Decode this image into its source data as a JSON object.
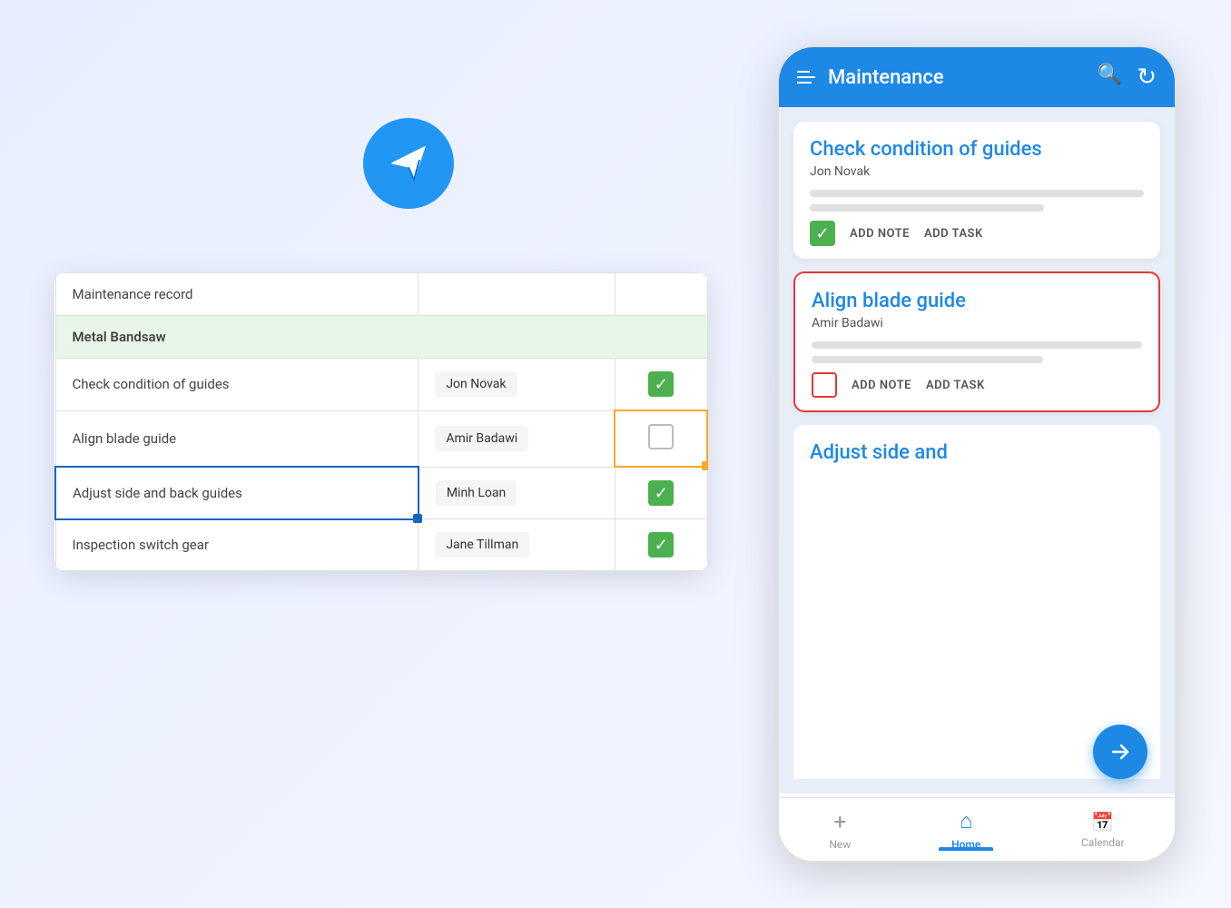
{
  "background": {
    "color": "#eef2ff"
  },
  "paperPlane": {
    "ariaLabel": "Paper plane icon"
  },
  "spreadsheet": {
    "headerRow": {
      "col1": "Maintenance record",
      "col2": "",
      "col3": ""
    },
    "sectionRow": "Metal Bandsaw",
    "rows": [
      {
        "task": "Check condition of guides",
        "assignee": "Jon Novak",
        "checked": true,
        "selected": false,
        "cellHighlighted": false
      },
      {
        "task": "Align blade guide",
        "assignee": "Amir Badawi",
        "checked": false,
        "selected": false,
        "cellHighlighted": true
      },
      {
        "task": "Adjust side and back guides",
        "assignee": "Minh Loan",
        "checked": true,
        "selected": true,
        "cellHighlighted": false
      },
      {
        "task": "Inspection switch gear",
        "assignee": "Jane Tillman",
        "checked": true,
        "selected": false,
        "cellHighlighted": false
      }
    ]
  },
  "phone": {
    "topbar": {
      "title": "Maintenance",
      "menuIcon": "≡",
      "searchIcon": "🔍",
      "refreshIcon": "↻"
    },
    "cards": [
      {
        "id": "card1",
        "title": "Check condition of guides",
        "assignee": "Jon Novak",
        "checked": true,
        "selected": false,
        "actions": [
          "ADD NOTE",
          "ADD TASK"
        ]
      },
      {
        "id": "card2",
        "title": "Align blade guide",
        "assignee": "Amir Badawi",
        "checked": false,
        "selected": true,
        "actions": [
          "ADD NOTE",
          "ADD TASK"
        ]
      }
    ],
    "partialCard": {
      "title": "Adjust side and"
    },
    "fab": {
      "icon": "→",
      "ariaLabel": "Navigate button"
    },
    "bottomNav": [
      {
        "label": "New",
        "icon": "+",
        "active": false
      },
      {
        "label": "Home",
        "icon": "⌂",
        "active": true
      },
      {
        "label": "Calendar",
        "icon": "📅",
        "active": false
      }
    ]
  }
}
